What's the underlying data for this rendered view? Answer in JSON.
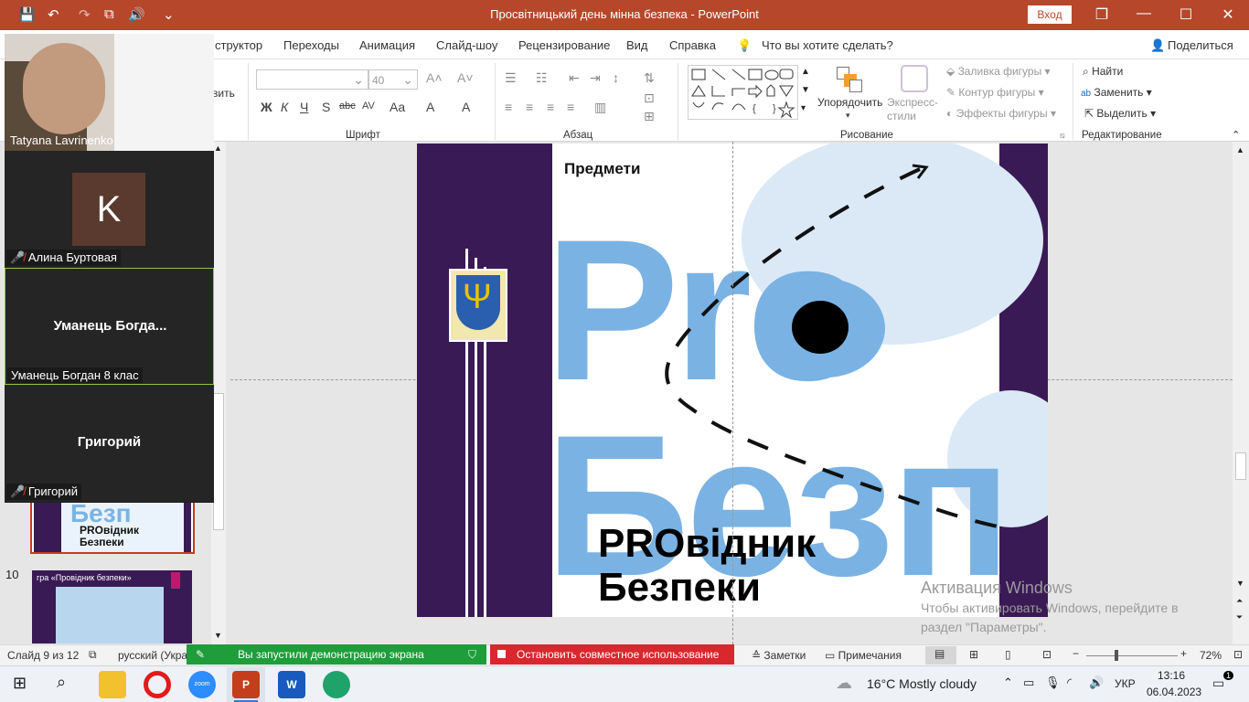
{
  "window": {
    "title": "Просвітницький день мінна безпека  -  PowerPoint",
    "signin": "Вход",
    "restore_icon": "❐",
    "minimize": "—",
    "maximize": "☐",
    "close": "✕"
  },
  "quick_access": {
    "save_icon": "💾",
    "undo_icon": "↶",
    "redo_icon": "↷",
    "present_icon": "⧉",
    "volume_icon": "🔊",
    "more": "⌄"
  },
  "menu": {
    "items": [
      "структор",
      "Переходы",
      "Анимация",
      "Слайд-шоу",
      "Рецензирование",
      "Вид",
      "Справка"
    ],
    "tellme": "Что вы хотите сделать?",
    "share": "Поделиться"
  },
  "ribbon": {
    "clipboard_partial": "вить",
    "font": {
      "label": "Шрифт",
      "size": "40",
      "bold": "Ж",
      "italic": "К",
      "underline": "Ч",
      "shadow": "S",
      "strike": "abc",
      "spacing": "AV",
      "case": "Aa",
      "clear": "A",
      "color": "A"
    },
    "paragraph": {
      "label": "Абзац"
    },
    "drawing": {
      "label": "Рисование",
      "arrange": "Упорядочить",
      "quick_styles": "Экспресс-стили",
      "fill": "Заливка фигуры",
      "outline": "Контур фигуры",
      "effects": "Эффекты фигуры"
    },
    "editing": {
      "label": "Редактирование",
      "find": "Найти",
      "replace": "Заменить",
      "select": "Выделить"
    }
  },
  "zoom_panel": {
    "participants": [
      {
        "name": "Tatyana Lavrinenko",
        "type": "video"
      },
      {
        "name": "Алина Буртовая",
        "initial": "K",
        "muted": true
      },
      {
        "name": "Уманець Богдан 8 клас",
        "display": "Уманець  Богда...",
        "active": true
      },
      {
        "name": "Григорий",
        "display": "Григорий",
        "muted": true
      }
    ]
  },
  "thumbnails": {
    "slide9_text": "PROвідник\nБезпеки",
    "slide10_number": "10",
    "slide10_title": "гра «Провідник безпеки»"
  },
  "slide": {
    "subtitle": "Предмети",
    "word1": "Pro",
    "word2": "Безп",
    "title_line1": "PROвідник",
    "title_line2": "Безпеки"
  },
  "watermark": {
    "title": "Активация Windows",
    "line2": "Чтобы активировать Windows, перейдите в",
    "line3": "раздел \"Параметры\"."
  },
  "status": {
    "slide": "Слайд 9 из 12",
    "lang": "русский (Укра",
    "sharing": "Вы запустили демонстрацию экрана",
    "stop": "Остановить совместное использование",
    "notes": "Заметки",
    "comments": "Примечания",
    "zoom": "72%"
  },
  "taskbar": {
    "weather": "16°C  Mostly cloudy",
    "lang": "УКР",
    "time": "13:16",
    "date": "06.04.2023",
    "notif_count": "1"
  },
  "colors": {
    "accent": "#b7472a",
    "zoom_green": "#1f9d3a",
    "zoom_red": "#d9272e",
    "slide_purple": "#3a1a55",
    "pro_blue": "#7ab3e3"
  }
}
